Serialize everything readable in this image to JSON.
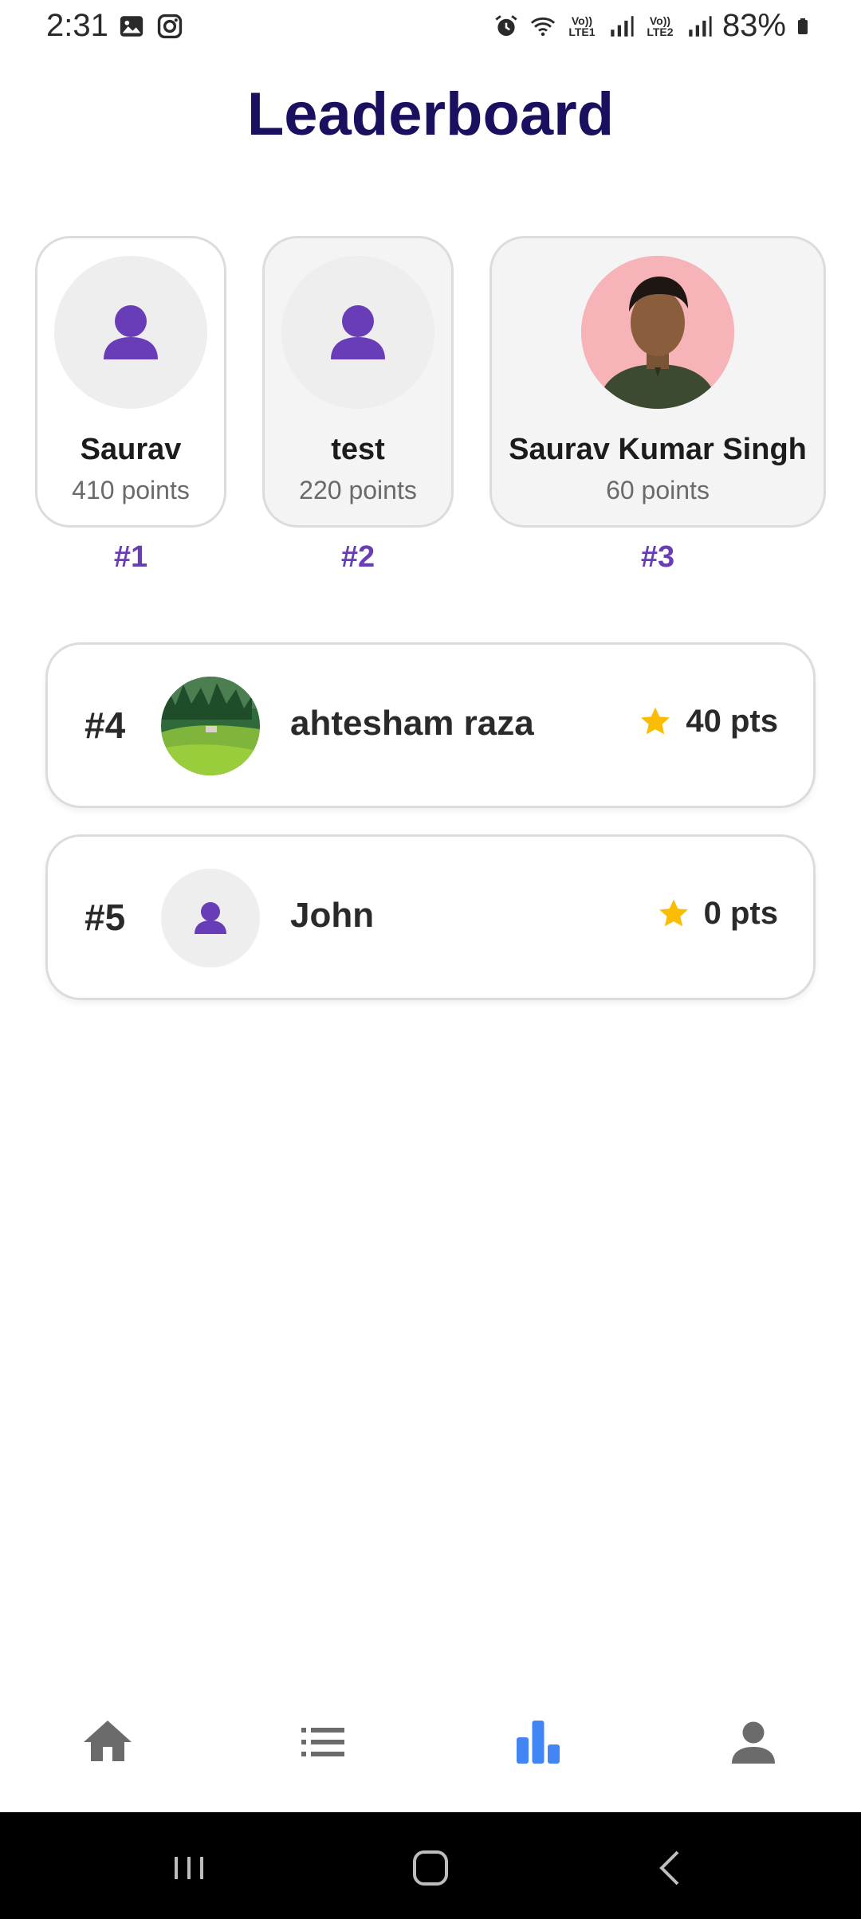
{
  "status_bar": {
    "time": "2:31",
    "battery": "83%",
    "sim1": "Vo)) LTE1",
    "sim2": "Vo)) LTE2",
    "icons": [
      "gallery-icon",
      "instagram-icon",
      "alarm-icon",
      "wifi-icon",
      "signal-icon",
      "battery-icon"
    ]
  },
  "header": {
    "title": "Leaderboard"
  },
  "podium": [
    {
      "name": "Saurav",
      "points": "410 points",
      "rank": "#1",
      "avatar": "default-avatar-icon"
    },
    {
      "name": "test",
      "points": "220 points",
      "rank": "#2",
      "avatar": "default-avatar-icon"
    },
    {
      "name": "Saurav Kumar Singh",
      "points": "60 points",
      "rank": "#3",
      "avatar": "profile-photo"
    }
  ],
  "list": [
    {
      "rank": "#4",
      "name": "ahtesham raza",
      "points": "40 pts",
      "avatar": "landscape-photo"
    },
    {
      "rank": "#5",
      "name": "John",
      "points": "0 pts",
      "avatar": "default-avatar-icon"
    }
  ],
  "bottom_nav": {
    "items": [
      {
        "name": "home",
        "icon": "home-icon",
        "active": false
      },
      {
        "name": "list",
        "icon": "list-icon",
        "active": false
      },
      {
        "name": "leaderboard",
        "icon": "bar-chart-icon",
        "active": true
      },
      {
        "name": "profile",
        "icon": "person-icon",
        "active": false
      }
    ]
  },
  "colors": {
    "title": "#1a1060",
    "accent": "#6a3db8",
    "star": "#fbbc04",
    "nav_active": "#4285f4",
    "nav_inactive": "#6b6b6b"
  }
}
